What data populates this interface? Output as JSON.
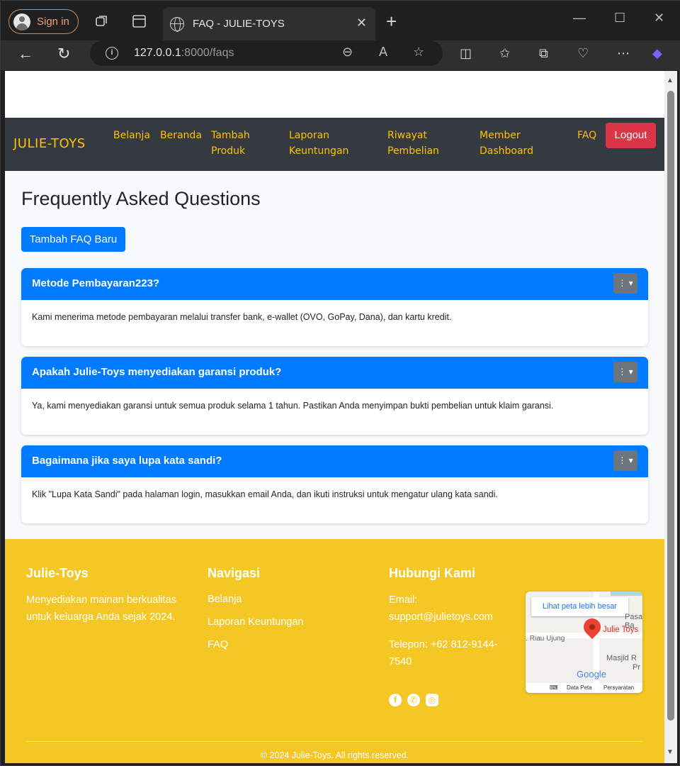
{
  "browser": {
    "signin_label": "Sign in",
    "tab_title": "FAQ - JULIE-TOYS",
    "url_host": "127.0.0.1",
    "url_path": ":8000/faqs"
  },
  "navbar": {
    "brand": "JULIE-TOYS",
    "links": [
      {
        "label_line1": "Belanja",
        "label_line2": ""
      },
      {
        "label_line1": "Beranda",
        "label_line2": ""
      },
      {
        "label_line1": "Tambah",
        "label_line2": "Produk"
      },
      {
        "label_line1": "Laporan",
        "label_line2": "Keuntungan"
      },
      {
        "label_line1": "Riwayat",
        "label_line2": "Pembelian"
      },
      {
        "label_line1": "Member",
        "label_line2": "Dashboard"
      },
      {
        "label_line1": "FAQ",
        "label_line2": ""
      }
    ],
    "logout_label": "Logout"
  },
  "main": {
    "title": "Frequently Asked Questions",
    "add_button": "Tambah FAQ Baru",
    "faqs": [
      {
        "question": "Metode Pembayaran223?",
        "answer": "Kami menerima metode pembayaran melalui transfer bank, e-wallet (OVO, GoPay, Dana), dan kartu kredit."
      },
      {
        "question": "Apakah Julie-Toys menyediakan garansi produk?",
        "answer": "Ya, kami menyediakan garansi untuk semua produk selama 1 tahun. Pastikan Anda menyimpan bukti pembelian untuk klaim garansi."
      },
      {
        "question": "Bagaimana jika saya lupa kata sandi?",
        "answer": "Klik \"Lupa Kata Sandi\" pada halaman login, masukkan email Anda, dan ikuti instruksi untuk mengatur ulang kata sandi."
      }
    ]
  },
  "footer": {
    "about_title": "Julie-Toys",
    "about_line1": "Menyediakan mainan berkualitas",
    "about_line2": "untuk keluarga Anda sejak 2024.",
    "nav_title": "Navigasi",
    "nav_links": [
      "Belanja",
      "Laporan Keuntungan",
      "FAQ"
    ],
    "contact_title": "Hubungi Kami",
    "email_label": "Email:",
    "email_value": "support@julietoys.com",
    "phone_line1": "Telepon: +62 812-9144-",
    "phone_line2": "7540",
    "map": {
      "big_map_link": "Lihat peta lebih besar",
      "label_pasar": "Pasar Ba",
      "label_julie": "Julie Toys",
      "label_riau": "l. Riau Ujung",
      "label_masjid": "Masjid R",
      "label_pr": "Pr",
      "google": "Google",
      "data_peta": "Data Peta",
      "persyaratan": "Persyaratan"
    },
    "copyright": "© 2024 Julie-Toys. All rights reserved."
  }
}
